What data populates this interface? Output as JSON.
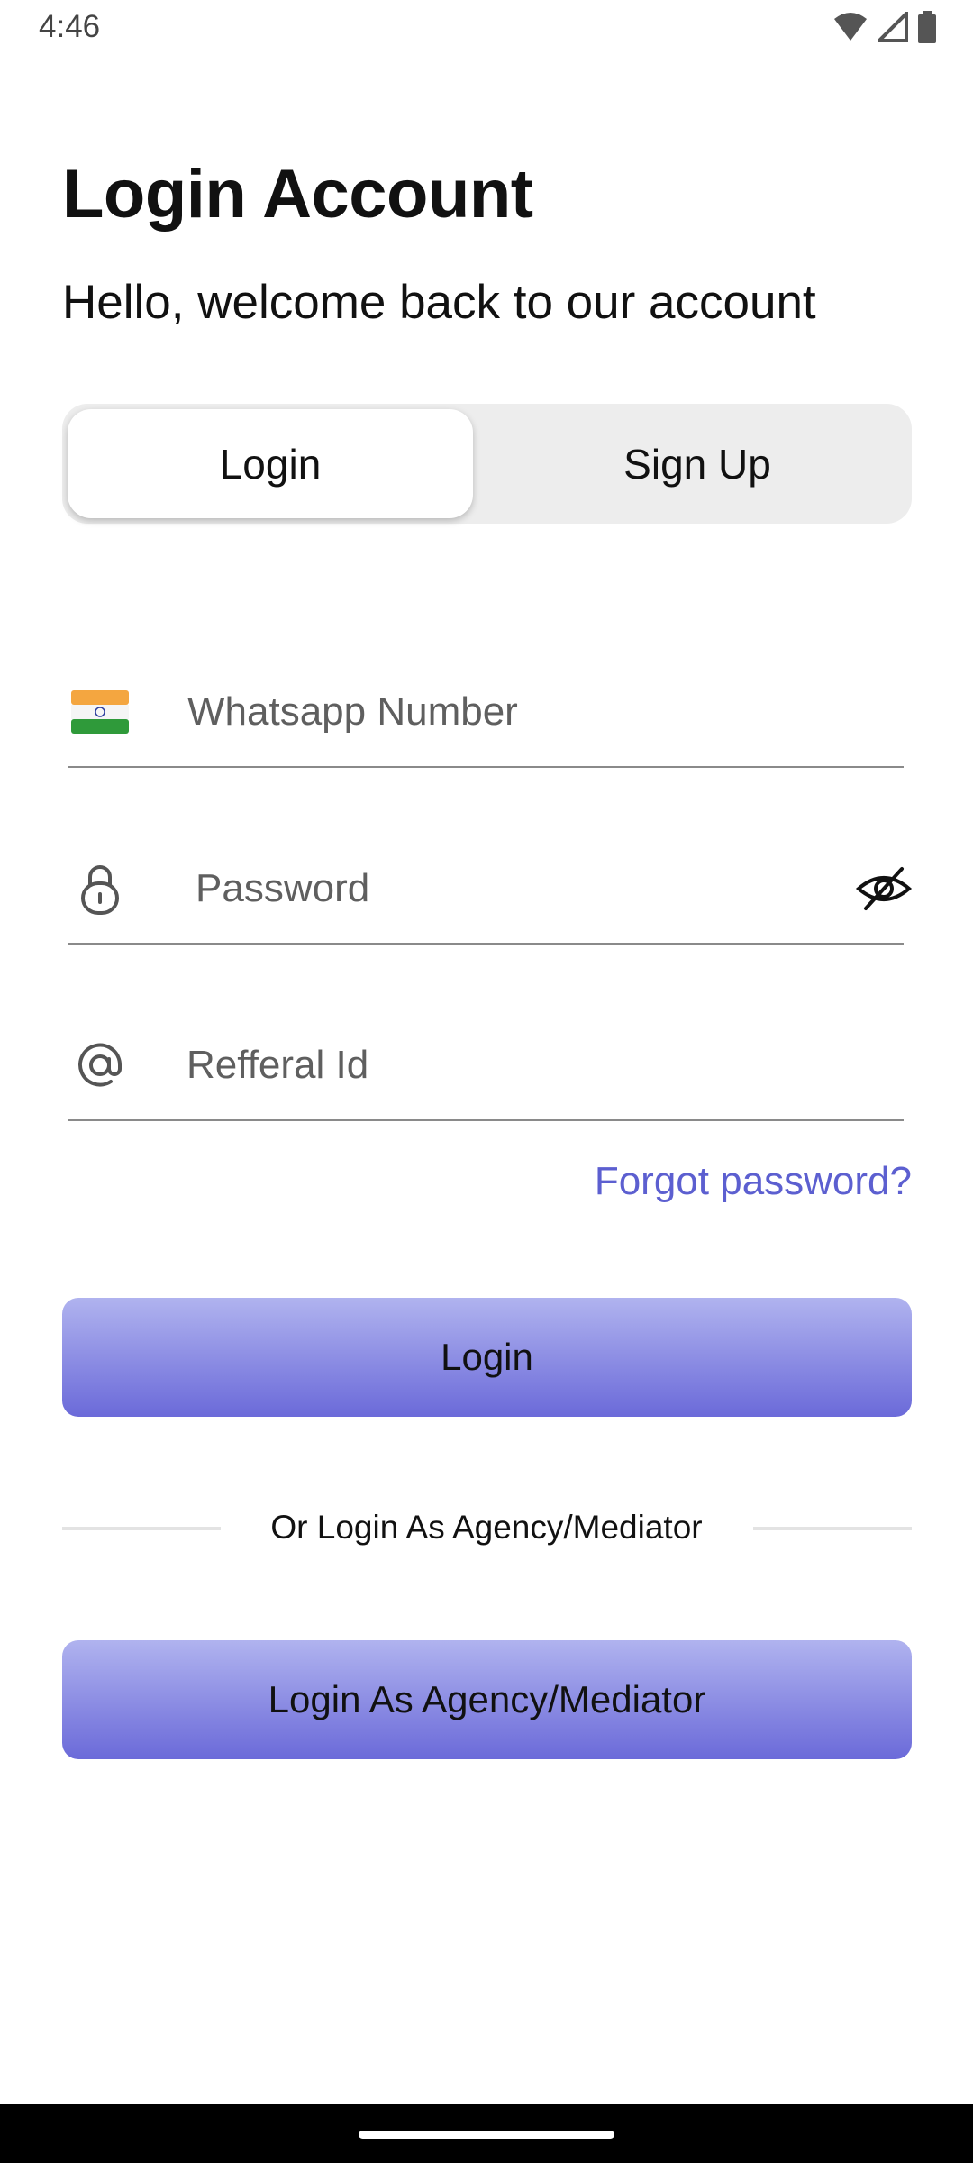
{
  "status_bar": {
    "time": "4:46"
  },
  "header": {
    "title": "Login Account",
    "subtitle": "Hello, welcome back to our account"
  },
  "tabs": [
    {
      "label": "Login",
      "active": true
    },
    {
      "label": "Sign Up",
      "active": false
    }
  ],
  "form": {
    "whatsapp": {
      "placeholder": "Whatsapp Number",
      "value": "",
      "flag": "india-flag-icon"
    },
    "password": {
      "placeholder": "Password",
      "value": "",
      "icon": "lock-icon",
      "toggle_icon": "eye-off-icon"
    },
    "referral": {
      "placeholder": "Refferal Id",
      "value": "",
      "icon": "at-sign-icon"
    },
    "forgot_label": "Forgot password?",
    "login_label": "Login"
  },
  "divider_text": "Or Login As Agency/Mediator",
  "agency_button_label": "Login As Agency/Mediator",
  "colors": {
    "accent": "#5c5fd0",
    "button_top": "#b0b3ef",
    "button_bottom": "#6b6ad9"
  }
}
